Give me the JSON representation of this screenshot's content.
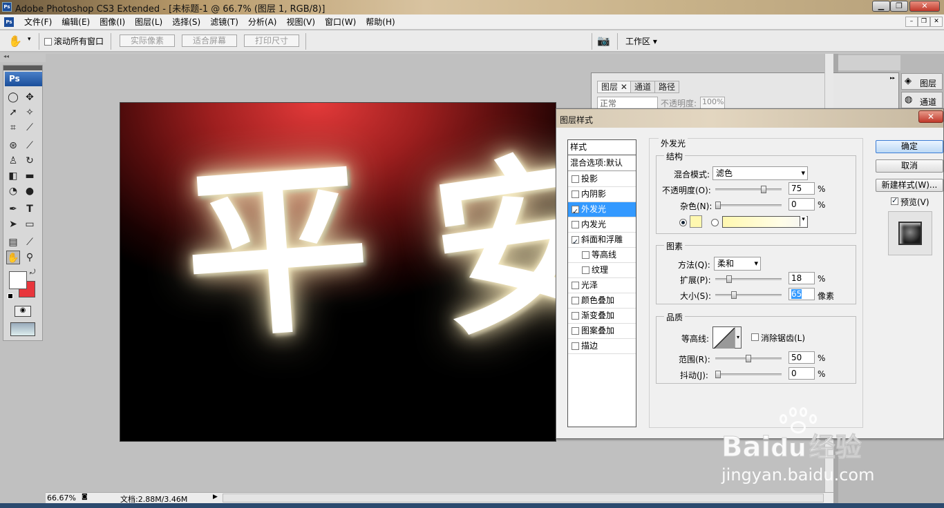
{
  "window": {
    "title": "Adobe Photoshop CS3 Extended - [未标题-1 @ 66.7% (图层 1, RGB/8)]",
    "app_icon": "Ps"
  },
  "menu": [
    "文件(F)",
    "编辑(E)",
    "图像(I)",
    "图层(L)",
    "选择(S)",
    "滤镜(T)",
    "分析(A)",
    "视图(V)",
    "窗口(W)",
    "帮助(H)"
  ],
  "options": {
    "scroll_all": "滚动所有窗口",
    "actual_pixels": "实际像素",
    "fit_screen": "适合屏幕",
    "print_size": "打印尺寸",
    "workspace": "工作区 ▾"
  },
  "toolbox": {
    "logo": "Ps"
  },
  "canvas": {
    "text": [
      "平",
      "安"
    ]
  },
  "layers_panel": {
    "tabs": [
      "图层",
      "通道",
      "路径"
    ],
    "blend": "正常",
    "opacity_label": "不透明度:",
    "opacity": "100%"
  },
  "dock": {
    "layers": "图层",
    "channels": "通道"
  },
  "status": {
    "zoom": "66.67%",
    "doc": "文档:2.88M/3.46M"
  },
  "dialog": {
    "title": "图层样式",
    "styles_header": "样式",
    "blend_options": "混合选项:默认",
    "styles": [
      {
        "label": "投影",
        "checked": false,
        "indent": false
      },
      {
        "label": "内阴影",
        "checked": false,
        "indent": false
      },
      {
        "label": "外发光",
        "checked": true,
        "indent": false,
        "selected": true
      },
      {
        "label": "内发光",
        "checked": false,
        "indent": false
      },
      {
        "label": "斜面和浮雕",
        "checked": true,
        "indent": false
      },
      {
        "label": "等高线",
        "checked": false,
        "indent": true
      },
      {
        "label": "纹理",
        "checked": false,
        "indent": true
      },
      {
        "label": "光泽",
        "checked": false,
        "indent": false
      },
      {
        "label": "颜色叠加",
        "checked": false,
        "indent": false
      },
      {
        "label": "渐变叠加",
        "checked": false,
        "indent": false
      },
      {
        "label": "图案叠加",
        "checked": false,
        "indent": false
      },
      {
        "label": "描边",
        "checked": false,
        "indent": false
      }
    ],
    "section_title": "外发光",
    "structure": {
      "legend": "结构",
      "blend_mode_label": "混合模式:",
      "blend_mode": "滤色",
      "opacity_label": "不透明度(O):",
      "opacity": "75",
      "opacity_level": 0.75,
      "noise_label": "杂色(N):",
      "noise": "0",
      "noise_level": 0,
      "glow_color": "#fff8b0",
      "percent": "%"
    },
    "elements": {
      "legend": "图素",
      "technique_label": "方法(Q):",
      "technique": "柔和",
      "spread_label": "扩展(P):",
      "spread": "18",
      "spread_level": 0.18,
      "size_label": "大小(S):",
      "size": "65",
      "size_level": 0.26,
      "percent": "%",
      "pixels": "像素"
    },
    "quality": {
      "legend": "品质",
      "contour_label": "等高线:",
      "antialias_label": "消除锯齿(L)",
      "range_label": "范围(R):",
      "range": "50",
      "range_level": 0.5,
      "jitter_label": "抖动(J):",
      "jitter": "0",
      "jitter_level": 0,
      "percent": "%"
    },
    "buttons": {
      "ok": "确定",
      "cancel": "取消",
      "new_style": "新建样式(W)...",
      "preview": "预览(V)"
    }
  },
  "watermark": {
    "brand": "Bai",
    "brand2": "du",
    "product": "经验",
    "url": "jingyan.baidu.com"
  }
}
